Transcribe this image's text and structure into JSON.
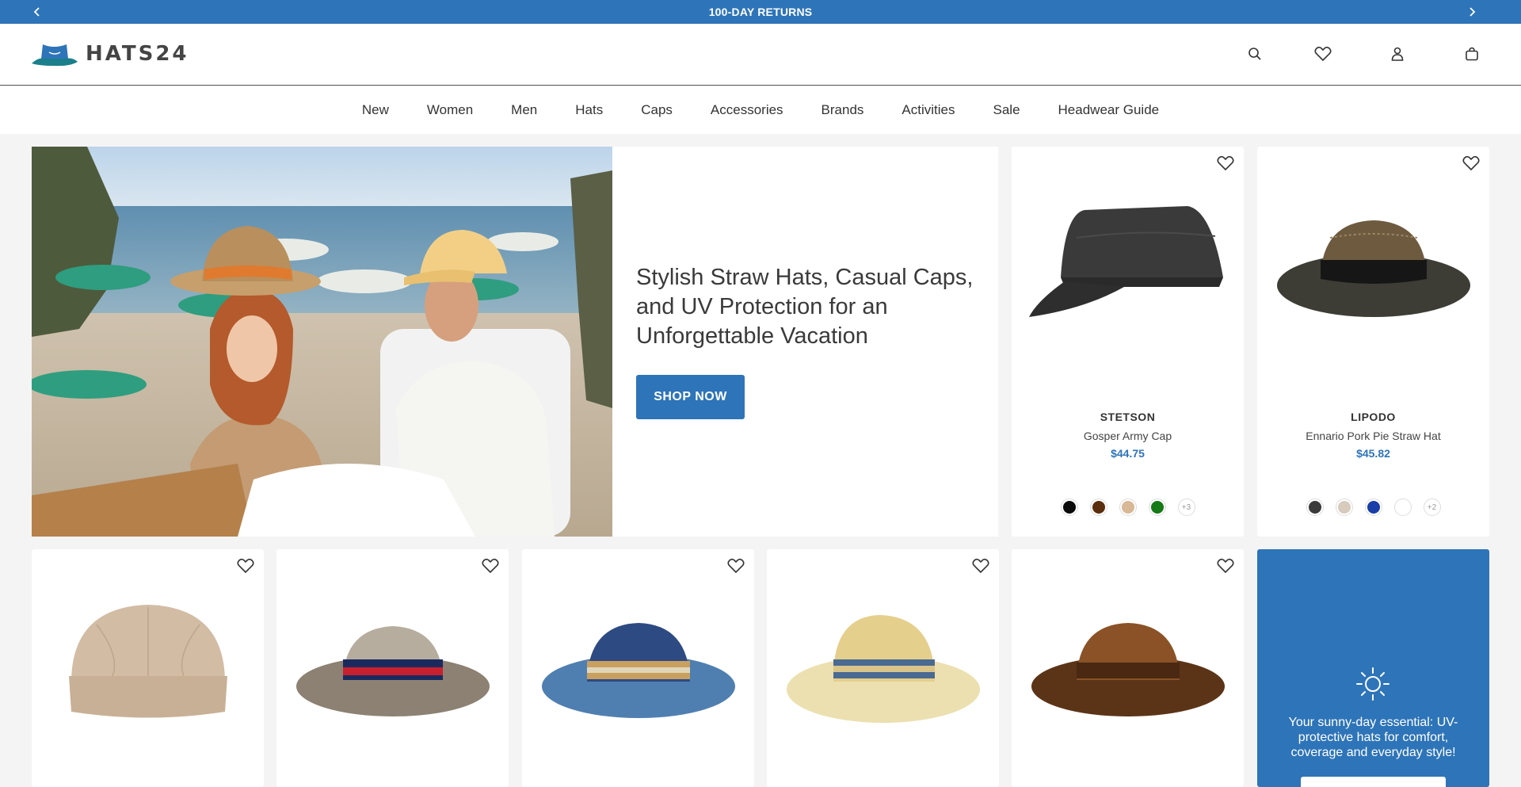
{
  "announcement": {
    "text": "100-DAY RETURNS"
  },
  "header": {
    "brand_name": "HATS24",
    "icons": [
      "search-icon",
      "heart-icon",
      "user-icon",
      "bag-icon"
    ]
  },
  "nav": [
    "New",
    "Women",
    "Men",
    "Hats",
    "Caps",
    "Accessories",
    "Brands",
    "Activities",
    "Sale",
    "Headwear Guide"
  ],
  "hero": {
    "headline": "Stylish Straw Hats, Casual Caps, and UV Protection for an Unforgettable Vacation",
    "cta": "SHOP NOW"
  },
  "featured_products": [
    {
      "brand": "STETSON",
      "name": "Gosper Army Cap",
      "price": "$44.75",
      "swatches": [
        "#0a0a0a",
        "#5a2e0c",
        "#d8b895",
        "#167a16"
      ],
      "more": "+3"
    },
    {
      "brand": "LIPODO",
      "name": "Ennario Pork Pie Straw Hat",
      "price": "$45.82",
      "swatches": [
        "#3a3a3a",
        "#d6cbbd",
        "#1a3ea8",
        "#ffffff"
      ],
      "more": "+2"
    }
  ],
  "product_row": [
    {
      "image": "beige-docker-cap"
    },
    {
      "image": "khaki-pork-pie-hat"
    },
    {
      "image": "blue-straw-pork-pie-hat"
    },
    {
      "image": "natural-straw-fedora"
    },
    {
      "image": "brown-straw-pork-pie-hat"
    }
  ],
  "promo": {
    "icon": "sun-icon",
    "text": "Your sunny-day essential: UV-protective hats for comfort, coverage and everyday style!"
  },
  "colors": {
    "accent": "#2e74b8",
    "background": "#f4f4f4"
  }
}
